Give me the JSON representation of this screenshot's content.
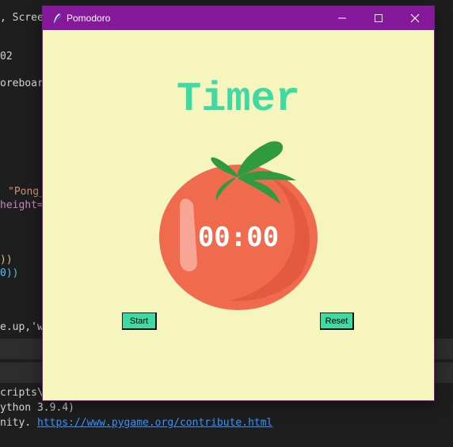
{
  "editor": {
    "lines": [
      ", Scree",
      "02",
      "oreboar",
      "\"Pong_",
      "height=",
      "))",
      "0))",
      "e.up,'w",
      "cripts\\",
      "ython 3.9.4)",
      "nity. "
    ],
    "link": "https://www.pygame.org/contribute.html"
  },
  "window": {
    "title": "Pomodoro",
    "icon": "feather-icon",
    "controls": [
      "minimize-icon",
      "maximize-icon",
      "close-icon"
    ]
  },
  "app": {
    "heading": "Timer",
    "time": "00:00",
    "start_label": "Start",
    "reset_label": "Reset",
    "colors": {
      "background": "#f7f5be",
      "accent": "#3fd9a3",
      "tomato": "#f06a4d",
      "titlebar": "#86199b"
    }
  }
}
